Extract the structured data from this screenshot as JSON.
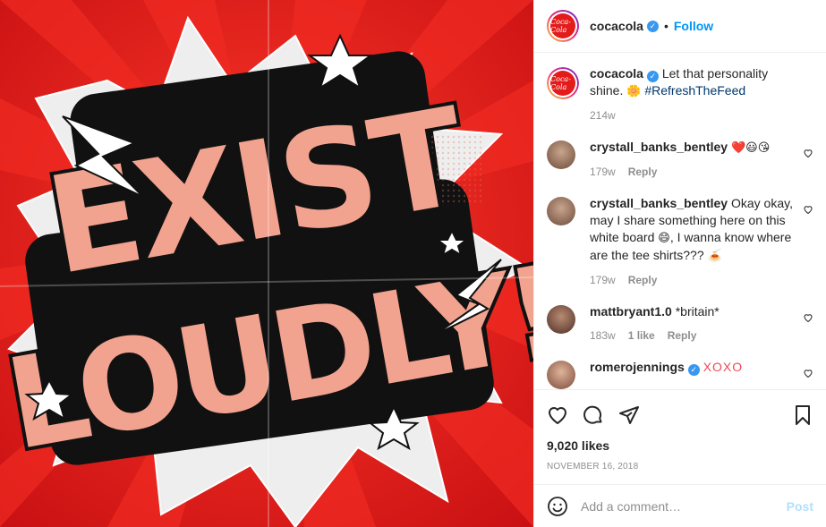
{
  "header": {
    "username": "cocacola",
    "separator": "•",
    "follow_label": "Follow",
    "avatar_logo_text": "Coca-Cola",
    "avatar_icon": "coca-cola-logo-icon",
    "verified_icon": "verified-badge-icon"
  },
  "image": {
    "line1": "EXIST",
    "line2": "LOUDLY!",
    "bg_color": "#e41b1b",
    "letter_color": "#f2a38f"
  },
  "caption": {
    "username": "cocacola",
    "text": "Let that personality shine. ",
    "emoji": "🌼",
    "hashtag": "#RefreshTheFeed",
    "time": "214w"
  },
  "comments": [
    {
      "username": "crystall_banks_bentley",
      "text": "",
      "emoji": "❤️😃😘",
      "time": "179w",
      "likes": "",
      "reply": "Reply"
    },
    {
      "username": "crystall_banks_bentley",
      "text": "Okay okay, may I share something here on this white board ",
      "emoji": "😄",
      "text2": ", I wanna know where are the tee shirts??? ",
      "emoji2": "🍝",
      "time": "179w",
      "likes": "",
      "reply": "Reply"
    },
    {
      "username": "mattbryant1.0",
      "text": "*britain*",
      "time": "183w",
      "likes": "1 like",
      "reply": "Reply"
    },
    {
      "username": "romerojennings",
      "text": "XOXO",
      "time": "",
      "likes": "",
      "reply": ""
    }
  ],
  "actions": {
    "like_icon": "heart-icon",
    "comment_icon": "comment-icon",
    "share_icon": "paper-plane-icon",
    "save_icon": "bookmark-icon",
    "likes": "9,020 likes",
    "date": "NOVEMBER 16, 2018"
  },
  "add_comment": {
    "placeholder": "Add a comment…",
    "post_label": "Post",
    "emoji_icon": "smiley-icon"
  }
}
